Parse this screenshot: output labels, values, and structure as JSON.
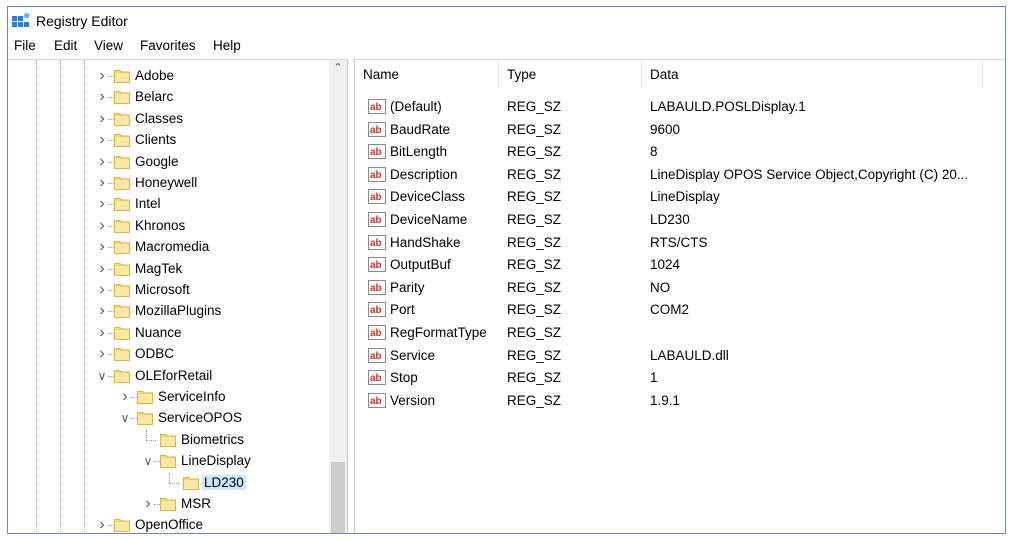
{
  "window": {
    "title": "Registry Editor"
  },
  "menu": [
    "File",
    "Edit",
    "View",
    "Favorites",
    "Help"
  ],
  "tree": [
    {
      "label": "Adobe",
      "depth": 0,
      "state": "collapsed"
    },
    {
      "label": "Belarc",
      "depth": 0,
      "state": "collapsed"
    },
    {
      "label": "Classes",
      "depth": 0,
      "state": "collapsed"
    },
    {
      "label": "Clients",
      "depth": 0,
      "state": "collapsed"
    },
    {
      "label": "Google",
      "depth": 0,
      "state": "collapsed"
    },
    {
      "label": "Honeywell",
      "depth": 0,
      "state": "collapsed"
    },
    {
      "label": "Intel",
      "depth": 0,
      "state": "collapsed"
    },
    {
      "label": "Khronos",
      "depth": 0,
      "state": "collapsed"
    },
    {
      "label": "Macromedia",
      "depth": 0,
      "state": "collapsed"
    },
    {
      "label": "MagTek",
      "depth": 0,
      "state": "collapsed"
    },
    {
      "label": "Microsoft",
      "depth": 0,
      "state": "collapsed"
    },
    {
      "label": "MozillaPlugins",
      "depth": 0,
      "state": "collapsed"
    },
    {
      "label": "Nuance",
      "depth": 0,
      "state": "collapsed"
    },
    {
      "label": "ODBC",
      "depth": 0,
      "state": "collapsed"
    },
    {
      "label": "OLEforRetail",
      "depth": 0,
      "state": "expanded"
    },
    {
      "label": "ServiceInfo",
      "depth": 1,
      "state": "collapsed"
    },
    {
      "label": "ServiceOPOS",
      "depth": 1,
      "state": "expanded"
    },
    {
      "label": "Biometrics",
      "depth": 2,
      "state": "leaf"
    },
    {
      "label": "LineDisplay",
      "depth": 2,
      "state": "expanded"
    },
    {
      "label": "LD230",
      "depth": 3,
      "state": "leaf",
      "selected": true
    },
    {
      "label": "MSR",
      "depth": 2,
      "state": "collapsed"
    },
    {
      "label": "OpenOffice",
      "depth": 0,
      "state": "collapsed"
    }
  ],
  "columns": {
    "name": "Name",
    "type": "Type",
    "data": "Data"
  },
  "values": [
    {
      "name": "(Default)",
      "type": "REG_SZ",
      "data": "LABAULD.POSLDisplay.1"
    },
    {
      "name": "BaudRate",
      "type": "REG_SZ",
      "data": "9600"
    },
    {
      "name": "BitLength",
      "type": "REG_SZ",
      "data": "8"
    },
    {
      "name": "Description",
      "type": "REG_SZ",
      "data": "LineDisplay OPOS Service Object,Copyright (C) 20..."
    },
    {
      "name": "DeviceClass",
      "type": "REG_SZ",
      "data": "LineDisplay"
    },
    {
      "name": "DeviceName",
      "type": "REG_SZ",
      "data": "LD230"
    },
    {
      "name": "HandShake",
      "type": "REG_SZ",
      "data": "RTS/CTS"
    },
    {
      "name": "OutputBuf",
      "type": "REG_SZ",
      "data": "1024"
    },
    {
      "name": "Parity",
      "type": "REG_SZ",
      "data": "NO"
    },
    {
      "name": "Port",
      "type": "REG_SZ",
      "data": "COM2"
    },
    {
      "name": "RegFormatType",
      "type": "REG_SZ",
      "data": ""
    },
    {
      "name": "Service",
      "type": "REG_SZ",
      "data": "LABAULD.dll"
    },
    {
      "name": "Stop",
      "type": "REG_SZ",
      "data": "1"
    },
    {
      "name": "Version",
      "type": "REG_SZ",
      "data": "1.9.1"
    }
  ],
  "icons": {
    "app": "registry-editor-icon",
    "folder": "folder-icon",
    "value": "string-value-icon"
  },
  "colors": {
    "selection": "#cce8ff",
    "folder": "#f5d77a",
    "value_icon": "#c0392b"
  }
}
